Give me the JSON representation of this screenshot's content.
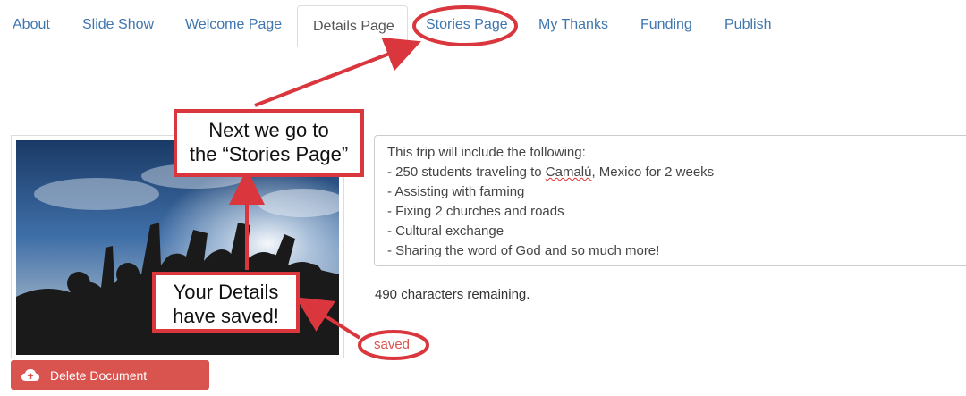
{
  "tabs": [
    {
      "label": "About",
      "active": false
    },
    {
      "label": "Slide Show",
      "active": false
    },
    {
      "label": "Welcome Page",
      "active": false
    },
    {
      "label": "Details Page",
      "active": true
    },
    {
      "label": "Stories Page",
      "active": false
    },
    {
      "label": "My Thanks",
      "active": false
    },
    {
      "label": "Funding",
      "active": false
    },
    {
      "label": "Publish",
      "active": false
    }
  ],
  "details": {
    "lines": [
      "This trip will include the following:",
      "- 250 students traveling to ",
      "- Assisting with farming",
      "- Fixing 2 churches and roads",
      "- Cultural exchange",
      "- Sharing the word of God and so much more!"
    ],
    "misspelled_word": "Camalú",
    "line2_suffix": ", Mexico for 2 weeks"
  },
  "remaining_text": "490 characters remaining.",
  "saved_text": "saved",
  "delete_button": {
    "label": "Delete Document",
    "icon": "cloud-upload-icon"
  },
  "annotations": {
    "next_line1": "Next we go to",
    "next_line2": "the “Stories Page”",
    "saved_line1": "Your Details",
    "saved_line2": "have saved!",
    "color": "#d9363e"
  },
  "colors": {
    "link": "#3f76ae",
    "danger": "#d9534f",
    "annotation": "#d9363e"
  }
}
